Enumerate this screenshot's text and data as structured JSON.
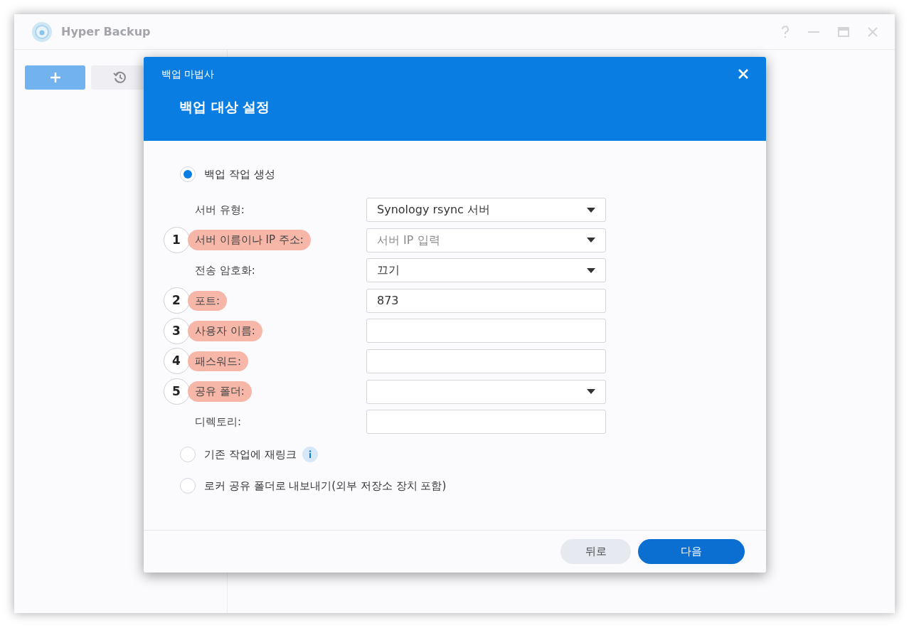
{
  "window": {
    "title": "Hyper Backup"
  },
  "dialog": {
    "title": "백업 마법사",
    "heading": "백업 대상 설정",
    "options": [
      {
        "label": "백업 작업 생성",
        "selected": true,
        "info": false
      },
      {
        "label": "기존 작업에 재링크",
        "selected": false,
        "info": true
      },
      {
        "label": "로커 공유 폴더로 내보내기(외부 저장소 장치 포함)",
        "selected": false,
        "info": false
      }
    ],
    "fields": [
      {
        "label": "서버 유형:",
        "kind": "select",
        "value": "Synology rsync 서버",
        "highlighted": false
      },
      {
        "label": "서버 이름이나 IP 주소:",
        "kind": "select",
        "placeholder": "서버 IP 입력",
        "highlighted": true,
        "annotation": "1"
      },
      {
        "label": "전송 암호화:",
        "kind": "select",
        "value": "끄기",
        "highlighted": false
      },
      {
        "label": "포트:",
        "kind": "input",
        "value": "873",
        "highlighted": true,
        "annotation": "2"
      },
      {
        "label": "사용자 이름:",
        "kind": "input",
        "highlighted": true,
        "annotation": "3"
      },
      {
        "label": "패스워드:",
        "kind": "input",
        "highlighted": true,
        "annotation": "4"
      },
      {
        "label": "공유 폴더:",
        "kind": "select",
        "highlighted": true,
        "annotation": "5"
      },
      {
        "label": "디렉토리:",
        "kind": "input",
        "highlighted": false
      }
    ],
    "buttons": [
      {
        "label": "뒤로",
        "kind": "secondary"
      },
      {
        "label": "다음",
        "kind": "primary"
      }
    ]
  }
}
